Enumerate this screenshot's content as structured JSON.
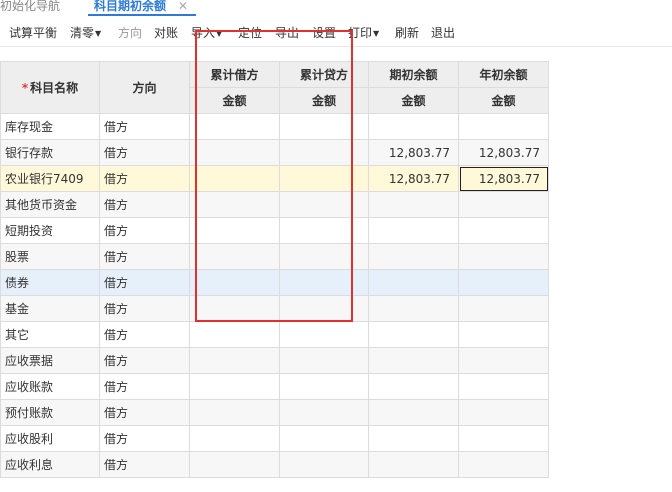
{
  "tabs": {
    "inactive_label": "初始化导航",
    "active_label": "科目期初余额",
    "close_symbol": "✕"
  },
  "toolbar": {
    "trial_balance": "试算平衡",
    "clear_zero": "清零",
    "direction": "方向",
    "reconcile": "对账",
    "import": "导入",
    "locate": "定位",
    "export": "导出",
    "settings": "设置",
    "print": "打印",
    "refresh": "刷新",
    "exit": "退出",
    "caret_icon": "chevron-down-icon"
  },
  "table": {
    "headers": {
      "name": "科目名称",
      "required_mark": "*",
      "direction": "方向",
      "cum_debit": "累计借方",
      "cum_credit": "累计贷方",
      "period_opening": "期初余额",
      "year_opening": "年初余额",
      "amount": "金额"
    },
    "rows": [
      {
        "name": "库存现金",
        "direction": "借方",
        "cum_debit": "",
        "cum_credit": "",
        "period_opening": "",
        "year_opening": ""
      },
      {
        "name": "银行存款",
        "direction": "借方",
        "cum_debit": "",
        "cum_credit": "",
        "period_opening": "12,803.77",
        "year_opening": "12,803.77"
      },
      {
        "name": "农业银行7409",
        "direction": "借方",
        "cum_debit": "",
        "cum_credit": "",
        "period_opening": "12,803.77",
        "year_opening": "12,803.77"
      },
      {
        "name": "其他货币资金",
        "direction": "借方",
        "cum_debit": "",
        "cum_credit": "",
        "period_opening": "",
        "year_opening": ""
      },
      {
        "name": "短期投资",
        "direction": "借方",
        "cum_debit": "",
        "cum_credit": "",
        "period_opening": "",
        "year_opening": ""
      },
      {
        "name": "股票",
        "direction": "借方",
        "cum_debit": "",
        "cum_credit": "",
        "period_opening": "",
        "year_opening": ""
      },
      {
        "name": "债券",
        "direction": "借方",
        "cum_debit": "",
        "cum_credit": "",
        "period_opening": "",
        "year_opening": ""
      },
      {
        "name": "基金",
        "direction": "借方",
        "cum_debit": "",
        "cum_credit": "",
        "period_opening": "",
        "year_opening": ""
      },
      {
        "name": "其它",
        "direction": "借方",
        "cum_debit": "",
        "cum_credit": "",
        "period_opening": "",
        "year_opening": ""
      },
      {
        "name": "应收票据",
        "direction": "借方",
        "cum_debit": "",
        "cum_credit": "",
        "period_opening": "",
        "year_opening": ""
      },
      {
        "name": "应收账款",
        "direction": "借方",
        "cum_debit": "",
        "cum_credit": "",
        "period_opening": "",
        "year_opening": ""
      },
      {
        "name": "预付账款",
        "direction": "借方",
        "cum_debit": "",
        "cum_credit": "",
        "period_opening": "",
        "year_opening": ""
      },
      {
        "name": "应收股利",
        "direction": "借方",
        "cum_debit": "",
        "cum_credit": "",
        "period_opening": "",
        "year_opening": ""
      },
      {
        "name": "应收利息",
        "direction": "借方",
        "cum_debit": "",
        "cum_credit": "",
        "period_opening": "",
        "year_opening": ""
      }
    ]
  },
  "colors": {
    "accent": "#2e7ad6",
    "annotation_box": "#e03030",
    "selected_row": "#fff9d9",
    "highlight_row": "#e6f0fb"
  }
}
